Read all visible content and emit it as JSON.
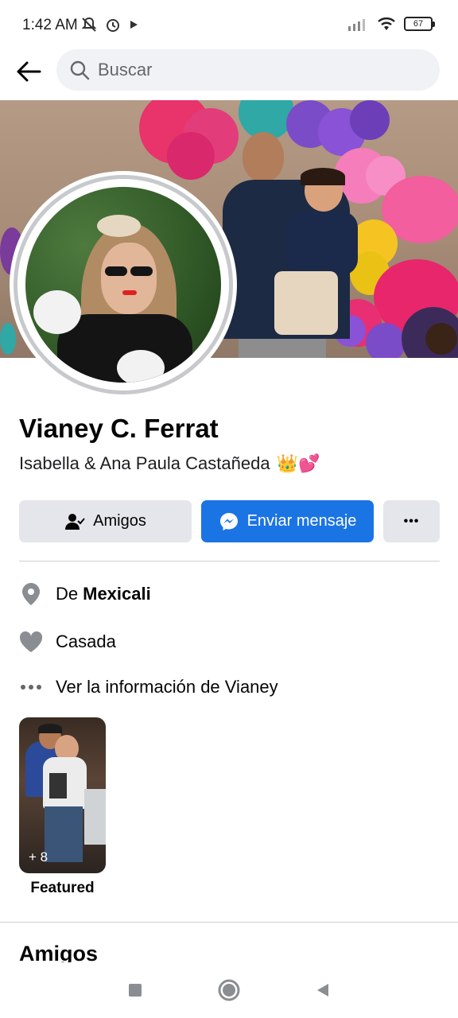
{
  "status_bar": {
    "time": "1:42 AM",
    "battery": "67"
  },
  "header": {
    "search_placeholder": "Buscar"
  },
  "profile": {
    "name": "Vianey C. Ferrat",
    "bio": "Isabella & Ana Paula Castañeda",
    "bio_emoji": "👑💕"
  },
  "actions": {
    "friends_label": "Amigos",
    "message_label": "Enviar mensaje",
    "more_label": "•••"
  },
  "details": {
    "location_prefix": "De",
    "location_city": "Mexicali",
    "relationship": "Casada",
    "see_info": "Ver la información de Vianey"
  },
  "featured": {
    "count": "+ 8",
    "label": "Featured"
  },
  "friends_section": {
    "title": "Amigos"
  },
  "colors": {
    "accent": "#1b74e4",
    "icon_gray": "#65676b"
  }
}
